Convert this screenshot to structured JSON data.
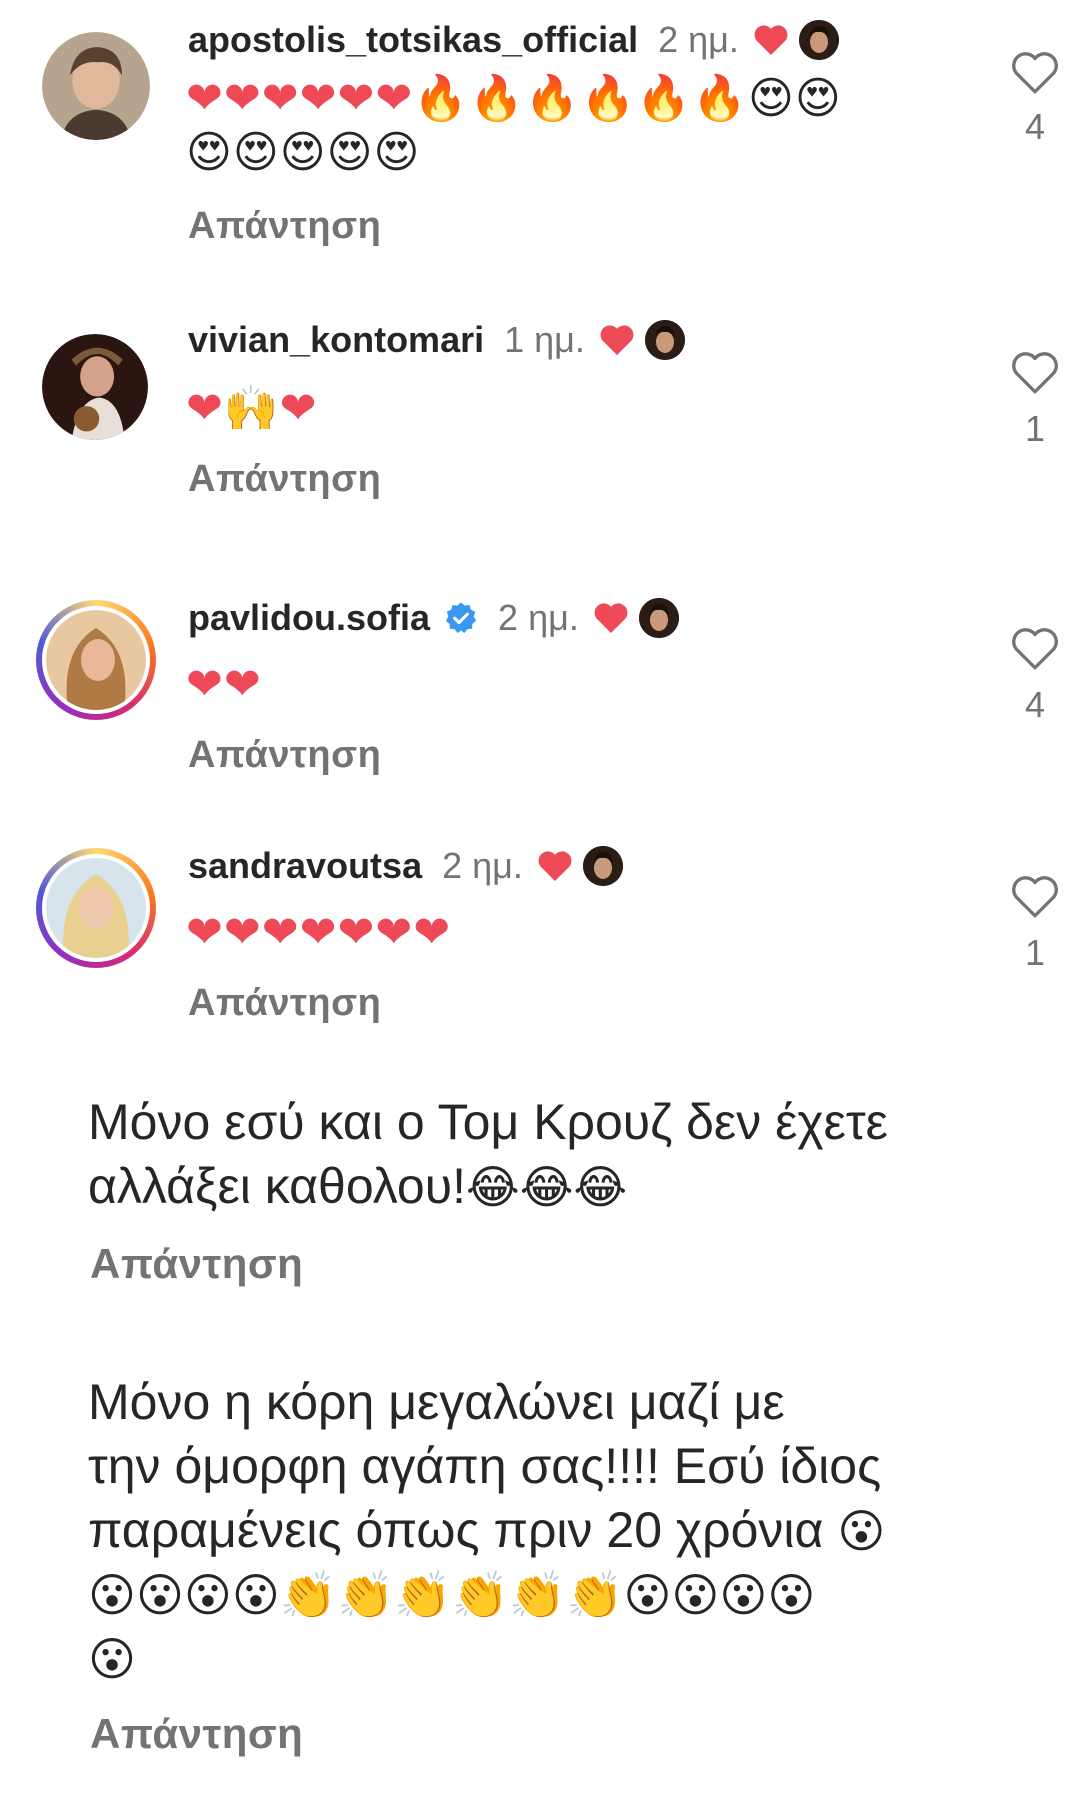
{
  "comments": [
    {
      "username": "apostolis_totsikas_official",
      "time": "2 ημ.",
      "emojis": "❤❤❤❤❤❤🔥🔥🔥🔥🔥🔥😍😍😍😍😍😍😍",
      "reply_label": "Απάντηση",
      "likes": "4",
      "verified": false
    },
    {
      "username": "vivian_kontomari",
      "time": "1 ημ.",
      "emojis": "❤🙌❤",
      "reply_label": "Απάντηση",
      "likes": "1",
      "verified": false
    },
    {
      "username": "pavlidou.sofia",
      "time": "2 ημ.",
      "emojis": "❤❤",
      "reply_label": "Απάντηση",
      "likes": "4",
      "verified": true
    },
    {
      "username": "sandravoutsa",
      "time": "2 ημ.",
      "emojis": "❤❤❤❤❤❤❤",
      "reply_label": "Απάντηση",
      "likes": "1",
      "verified": false
    }
  ],
  "text_comments": [
    {
      "line1": "Μόνο εσύ και ο Τομ Κρουζ δεν έχετε",
      "line2": "αλλάξει καθολου!",
      "line2_emojis": "😂😂😂",
      "reply_label": "Απάντηση"
    },
    {
      "line1": "Μόνο η κόρη μεγαλώνει μαζί με",
      "line2": "την όμορφη αγάπη σας!!!! Εσύ ίδιος",
      "line3": "παραμένεις όπως πριν 20 χρόνια",
      "line3_emojis": "😮",
      "line4_emojis": "😮😮😮😮👏👏👏👏👏👏😮😮😮😮",
      "line5_emojis": "😮",
      "reply_label": "Απάντηση"
    }
  ],
  "colors": {
    "text": "#262626",
    "secondary": "#737373",
    "heart": "#ed4956",
    "verified": "#3897f0"
  }
}
